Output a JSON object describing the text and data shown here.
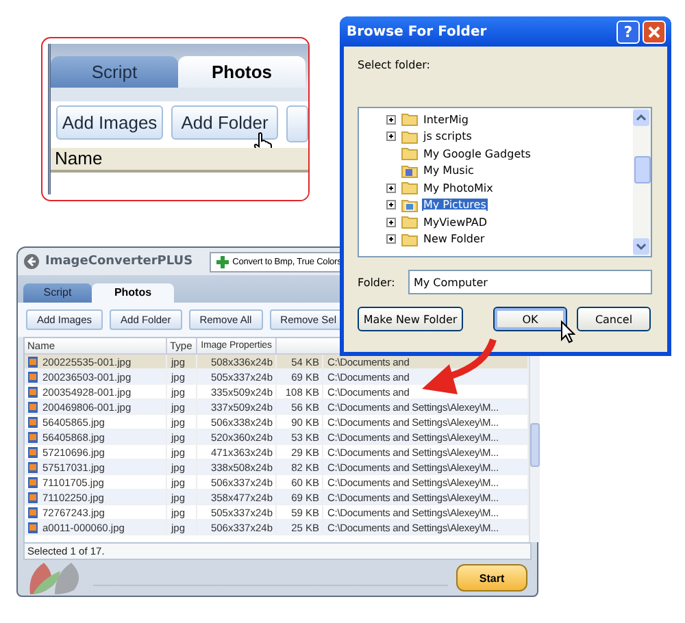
{
  "callout": {
    "tabs": [
      {
        "label": "Script",
        "selected": false
      },
      {
        "label": "Photos",
        "selected": true
      }
    ],
    "buttons": [
      {
        "label": "Add Images",
        "hovered": false
      },
      {
        "label": "Add Folder",
        "hovered": true
      }
    ],
    "column": "Name"
  },
  "dialog": {
    "title": "Browse For Folder",
    "help_button": "?",
    "prompt": "Select folder:",
    "tree": [
      {
        "label": "InterMig",
        "kind": "folder",
        "expandable": true,
        "selected": false
      },
      {
        "label": "js scripts",
        "kind": "folder",
        "expandable": true,
        "selected": false
      },
      {
        "label": "My Google Gadgets",
        "kind": "folder",
        "expandable": false,
        "selected": false
      },
      {
        "label": "My Music",
        "kind": "music",
        "expandable": false,
        "selected": false
      },
      {
        "label": "My PhotoMix",
        "kind": "folder",
        "expandable": true,
        "selected": false
      },
      {
        "label": "My Pictures",
        "kind": "pictures",
        "expandable": true,
        "selected": true
      },
      {
        "label": "MyViewPAD",
        "kind": "folder",
        "expandable": true,
        "selected": false
      },
      {
        "label": "New Folder",
        "kind": "folder",
        "expandable": true,
        "selected": false
      }
    ],
    "folder_label": "Folder:",
    "folder_value": "My Computer",
    "buttons": [
      {
        "label": "Make New Folder",
        "hovered": false,
        "focused": false
      },
      {
        "label": "OK",
        "hovered": true,
        "focused": true
      },
      {
        "label": "Cancel",
        "hovered": false,
        "focused": false
      }
    ]
  },
  "app": {
    "title": "ImageConverterPLUS",
    "preset": "Convert to Bmp, True Colors",
    "tabs": [
      {
        "label": "Script",
        "selected": false
      },
      {
        "label": "Photos",
        "selected": true
      }
    ],
    "buttons": [
      "Add Images",
      "Add Folder",
      "Remove All",
      "Remove Sel"
    ],
    "columns": [
      "Name",
      "Type",
      "Image Properties"
    ],
    "rows": [
      {
        "cells": [
          "200225535-001.jpg",
          "jpg",
          "508x336x24b",
          "54 KB",
          "C:\\Documents and"
        ],
        "selected": true
      },
      {
        "cells": [
          "200236503-001.jpg",
          "jpg",
          "505x337x24b",
          "69 KB",
          "C:\\Documents and"
        ],
        "selected": false
      },
      {
        "cells": [
          "200354928-001.jpg",
          "jpg",
          "335x509x24b",
          "108 KB",
          "C:\\Documents and"
        ],
        "selected": false
      },
      {
        "cells": [
          "200469806-001.jpg",
          "jpg",
          "337x509x24b",
          "56 KB",
          "C:\\Documents and Settings\\Alexey\\M..."
        ],
        "selected": false
      },
      {
        "cells": [
          "56405865.jpg",
          "jpg",
          "506x338x24b",
          "90 KB",
          "C:\\Documents and Settings\\Alexey\\M..."
        ],
        "selected": false
      },
      {
        "cells": [
          "56405868.jpg",
          "jpg",
          "520x360x24b",
          "53 KB",
          "C:\\Documents and Settings\\Alexey\\M..."
        ],
        "selected": false
      },
      {
        "cells": [
          "57210696.jpg",
          "jpg",
          "471x363x24b",
          "29 KB",
          "C:\\Documents and Settings\\Alexey\\M..."
        ],
        "selected": false
      },
      {
        "cells": [
          "57517031.jpg",
          "jpg",
          "338x508x24b",
          "82 KB",
          "C:\\Documents and Settings\\Alexey\\M..."
        ],
        "selected": false
      },
      {
        "cells": [
          "71101705.jpg",
          "jpg",
          "506x337x24b",
          "60 KB",
          "C:\\Documents and Settings\\Alexey\\M..."
        ],
        "selected": false
      },
      {
        "cells": [
          "71102250.jpg",
          "jpg",
          "358x477x24b",
          "69 KB",
          "C:\\Documents and Settings\\Alexey\\M..."
        ],
        "selected": false
      },
      {
        "cells": [
          "72767243.jpg",
          "jpg",
          "505x337x24b",
          "59 KB",
          "C:\\Documents and Settings\\Alexey\\M..."
        ],
        "selected": false
      },
      {
        "cells": [
          "a0011-000060.jpg",
          "jpg",
          "506x337x24b",
          "25 KB",
          "C:\\Documents and Settings\\Alexey\\M..."
        ],
        "selected": false
      }
    ],
    "status": "Selected 1 of 17.",
    "start_button": "Start"
  }
}
